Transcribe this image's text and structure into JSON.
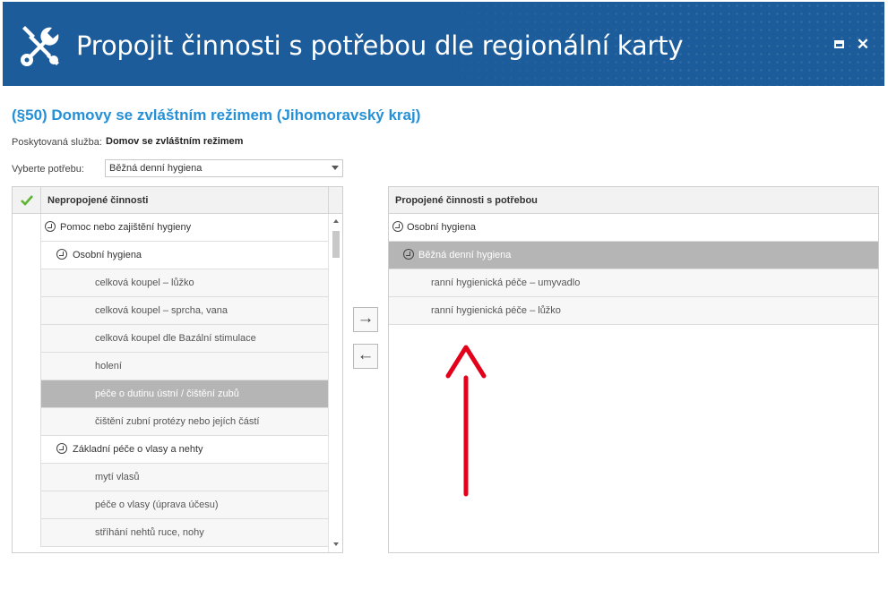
{
  "window": {
    "title": "Propojit činnosti s potřebou dle regionální karty",
    "icons": {
      "app": "wrench-screwdriver-icon",
      "maximize": "maximize-icon",
      "close": "close-icon"
    },
    "close_glyph": "✕"
  },
  "page": {
    "title": "(§50) Domovy se zvláštním režimem (Jihomoravský kraj)",
    "service_label": "Poskytovaná služba:",
    "service_value": "Domov se zvláštním režimem",
    "need_label": "Vyberte potřebu:",
    "need_value": "Běžná denní hygiena"
  },
  "left_grid": {
    "header": "Nepropojené činnosti",
    "rows": [
      {
        "text": "Pomoc nebo zajištění hygieny",
        "level": 0,
        "group": true,
        "selected": false
      },
      {
        "text": "Osobní hygiena",
        "level": 1,
        "group": true,
        "selected": false
      },
      {
        "text": "celková koupel – lůžko",
        "level": 2,
        "group": false,
        "selected": false
      },
      {
        "text": "celková koupel – sprcha, vana",
        "level": 2,
        "group": false,
        "selected": false
      },
      {
        "text": "celková koupel dle Bazální stimulace",
        "level": 2,
        "group": false,
        "selected": false
      },
      {
        "text": "holení",
        "level": 2,
        "group": false,
        "selected": false
      },
      {
        "text": "péče o dutinu ústní / čištění zubů",
        "level": 2,
        "group": false,
        "selected": true
      },
      {
        "text": "čištění zubní protézy nebo jejích částí",
        "level": 2,
        "group": false,
        "selected": false
      },
      {
        "text": "Základní péče o vlasy a nehty",
        "level": 1,
        "group": true,
        "selected": false
      },
      {
        "text": "mytí vlasů",
        "level": 2,
        "group": false,
        "selected": false
      },
      {
        "text": "péče o vlasy (úprava účesu)",
        "level": 2,
        "group": false,
        "selected": false
      },
      {
        "text": "stříhání nehtů ruce, nohy",
        "level": 2,
        "group": false,
        "selected": false
      }
    ]
  },
  "buttons": {
    "move_right": "→",
    "move_left": "←"
  },
  "right_grid": {
    "header": "Propojené činnosti s potřebou",
    "rows": [
      {
        "text": "Osobní hygiena",
        "level": 0,
        "group": true,
        "selected": false
      },
      {
        "text": "Běžná denní hygiena",
        "level": 1,
        "group": true,
        "selected": true
      },
      {
        "text": "ranní hygienická péče – umyvadlo",
        "level": 2,
        "group": false,
        "selected": false
      },
      {
        "text": "ranní hygienická péče – lůžko",
        "level": 2,
        "group": false,
        "selected": false
      }
    ]
  },
  "colors": {
    "header_bg": "#1c5c9a",
    "title_blue": "#2690d6",
    "selected_row": "#b5b5b5",
    "annotation_red": "#e3001b",
    "check_green": "#5cb531"
  }
}
